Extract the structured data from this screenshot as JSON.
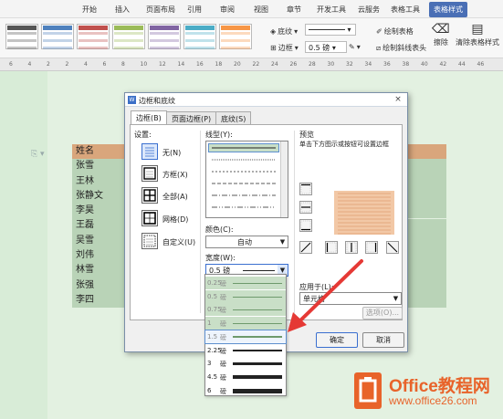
{
  "ribbon": {
    "tabs": [
      "开始",
      "插入",
      "页面布局",
      "引用",
      "审阅",
      "视图",
      "章节",
      "开发工具",
      "云服务",
      "表格工具",
      "表格样式"
    ],
    "active_tab": "表格样式",
    "shading_label": "底纹",
    "border_label": "边框",
    "line_width": "0.5",
    "line_unit": "磅",
    "draw_table_label": "绘制表格",
    "draw_diagonal_label": "绘制斜线表头",
    "erase_label": "擦除",
    "clear_style_label": "清除表格样式",
    "style_colors": [
      "#555555",
      "#4f81bd",
      "#c0504d",
      "#9bbb59",
      "#8064a2",
      "#4bacc6",
      "#f79646"
    ]
  },
  "ruler": {
    "ticks": [
      "6",
      "4",
      "2",
      "2",
      "4",
      "6",
      "8",
      "10",
      "12",
      "14",
      "16",
      "18",
      "20",
      "22",
      "24",
      "26",
      "28",
      "30",
      "32",
      "34",
      "36",
      "38",
      "40",
      "42",
      "44",
      "46"
    ]
  },
  "document": {
    "header_cell": "姓名",
    "names": [
      "张雪",
      "王林",
      "张静文",
      "李昊",
      "王磊",
      "吴雪",
      "刘伟",
      "林雪",
      "张强",
      "李四"
    ],
    "header_color": "#d9a67c",
    "row_color": "#b9d3b7"
  },
  "dialog": {
    "title": "边框和底纹",
    "close": "×",
    "tabs": [
      "边框(B)",
      "页面边框(P)",
      "底纹(S)"
    ],
    "active_tab": "边框(B)",
    "settings_label": "设置:",
    "settings": [
      {
        "label": "无(N)",
        "selected": true
      },
      {
        "label": "方框(X)",
        "selected": false
      },
      {
        "label": "全部(A)",
        "selected": false
      },
      {
        "label": "网格(D)",
        "selected": false
      },
      {
        "label": "自定义(U)",
        "selected": false
      }
    ],
    "line_style_label": "线型(Y):",
    "color_label": "颜色(C):",
    "color_value": "自动",
    "width_label": "宽度(W):",
    "width_value": "0.5   磅",
    "preview_label": "预览",
    "preview_hint": "单击下方图示或按钮可设置边框",
    "apply_to_label": "应用于(L):",
    "apply_to_value": "单元格",
    "options_button": "选项(O)...",
    "ok_button": "确定",
    "cancel_button": "取消"
  },
  "width_options": [
    {
      "value": "0.25",
      "unit": "磅",
      "weight": 1,
      "state": "grey"
    },
    {
      "value": "0.5",
      "unit": "磅",
      "weight": 1,
      "state": "grey"
    },
    {
      "value": "0.75",
      "unit": "磅",
      "weight": 1,
      "state": "grey"
    },
    {
      "value": "1",
      "unit": "磅",
      "weight": 1,
      "state": "grey"
    },
    {
      "value": "1.5",
      "unit": "磅",
      "weight": 2,
      "state": "hover"
    },
    {
      "value": "2.25",
      "unit": "磅",
      "weight": 2,
      "state": "normal"
    },
    {
      "value": "3",
      "unit": "磅",
      "weight": 3,
      "state": "normal"
    },
    {
      "value": "4.5",
      "unit": "磅",
      "weight": 4,
      "state": "normal"
    },
    {
      "value": "6",
      "unit": "磅",
      "weight": 5,
      "state": "normal"
    }
  ],
  "watermark": {
    "title": "Office教程网",
    "url": "www.office26.com",
    "color": "#e8632a"
  }
}
